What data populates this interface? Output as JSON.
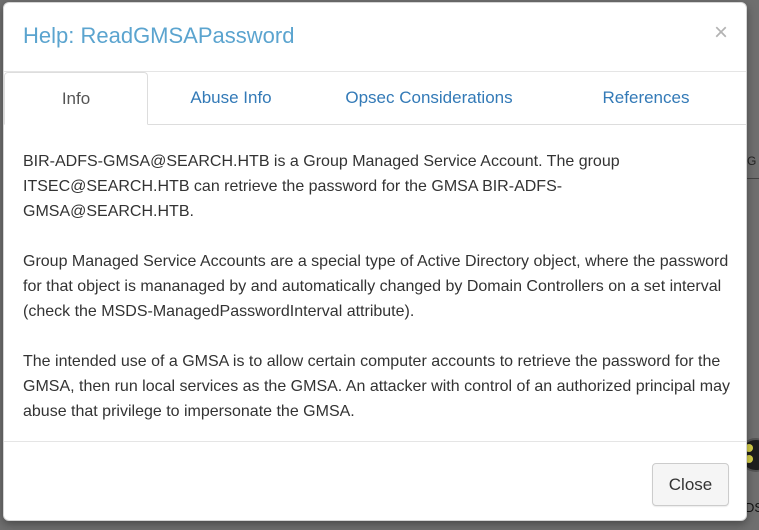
{
  "modal": {
    "title": "Help: ReadGMSAPassword",
    "close_icon": "×",
    "tabs": [
      {
        "label": "Info",
        "active": true
      },
      {
        "label": "Abuse Info",
        "active": false
      },
      {
        "label": "Opsec Considerations",
        "active": false
      },
      {
        "label": "References",
        "active": false
      }
    ],
    "paragraphs": [
      "BIR-ADFS-GMSA@SEARCH.HTB is a Group Managed Service Account. The group ITSEC@SEARCH.HTB can retrieve the password for the GMSA BIR-ADFS-GMSA@SEARCH.HTB.",
      "Group Managed Service Accounts are a special type of Active Directory object, where the password for that object is mananaged by and automatically changed by Domain Controllers on a set interval (check the MSDS-ManagedPasswordInterval attribute).",
      "The intended use of a GMSA is to allow certain computer accounts to retrieve the password for the GMSA, then run local services as the GMSA. An attacker with control of an authorized principal may abuse that privilege to impersonate the GMSA."
    ],
    "close_button": "Close"
  },
  "background": {
    "label_top": "G",
    "label_bottom": "DS"
  },
  "colors": {
    "title": "#5ba4cf",
    "tab_link": "#337ab7",
    "text": "#333333",
    "overlay": "#6f6f6f"
  }
}
